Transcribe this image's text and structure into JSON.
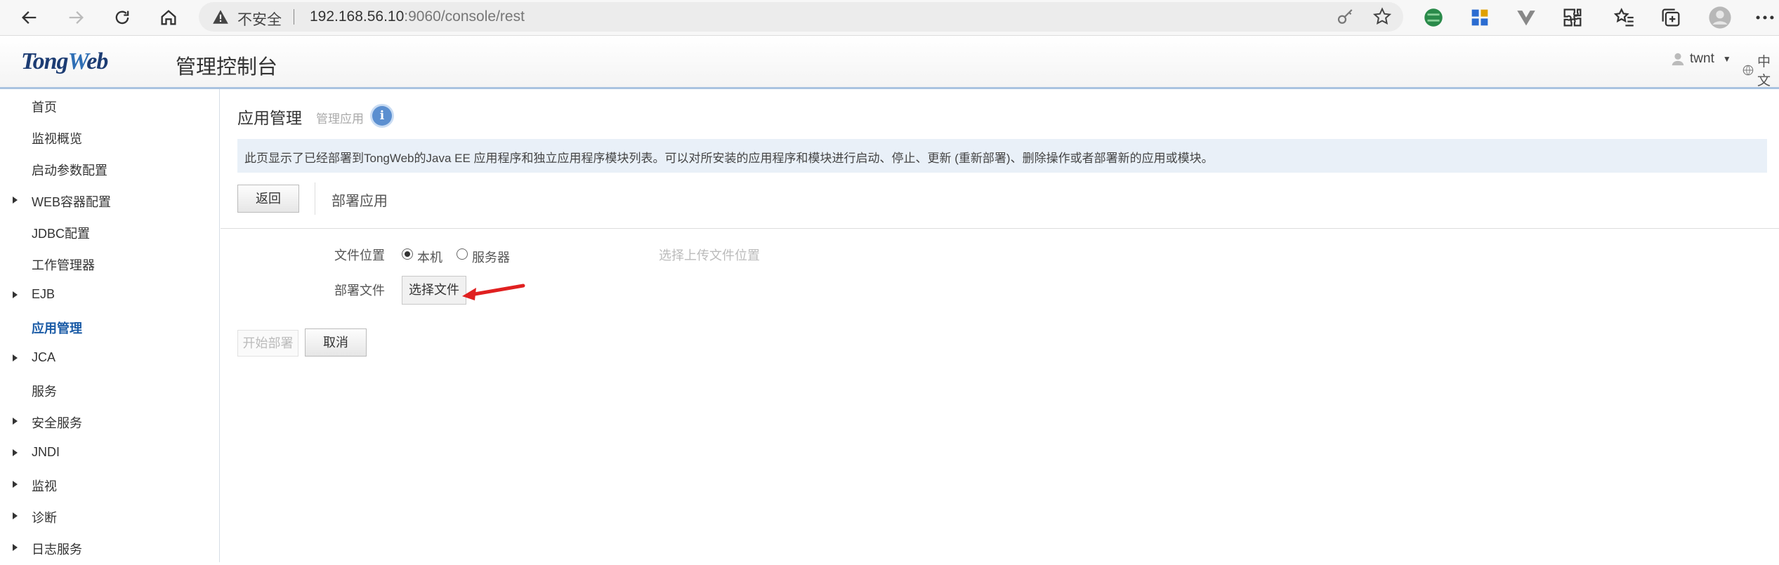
{
  "browser": {
    "insecure_label": "不安全",
    "url_host": "192.168.56.10",
    "url_rest": ":9060/console/rest"
  },
  "header": {
    "logo_tong": "Tong",
    "logo_w": "W",
    "logo_eb": "eb",
    "title": "管理控制台",
    "user": "twnt",
    "lang": "中文"
  },
  "sidebar": {
    "items": [
      {
        "label": "首页",
        "expandable": false
      },
      {
        "label": "监视概览",
        "expandable": false
      },
      {
        "label": "启动参数配置",
        "expandable": false
      },
      {
        "label": "WEB容器配置",
        "expandable": true
      },
      {
        "label": "JDBC配置",
        "expandable": false
      },
      {
        "label": "工作管理器",
        "expandable": false
      },
      {
        "label": "EJB",
        "expandable": true
      },
      {
        "label": "应用管理",
        "expandable": false,
        "active": true
      },
      {
        "label": "JCA",
        "expandable": true
      },
      {
        "label": "服务",
        "expandable": false
      },
      {
        "label": "安全服务",
        "expandable": true
      },
      {
        "label": "JNDI",
        "expandable": true
      },
      {
        "label": "监视",
        "expandable": true
      },
      {
        "label": "诊断",
        "expandable": true
      },
      {
        "label": "日志服务",
        "expandable": true
      }
    ]
  },
  "main": {
    "title": "应用管理",
    "subtitle": "管理应用",
    "info_glyph": "i",
    "notice": "此页显示了已经部署到TongWeb的Java EE 应用程序和独立应用程序模块列表。可以对所安装的应用程序和模块进行启动、停止、更新 (重新部署)、删除操作或者部署新的应用或模块。",
    "back_label": "返回",
    "deploy_title": "部署应用",
    "file_location_label": "文件位置",
    "radio_local": "本机",
    "radio_server": "服务器",
    "upload_hint": "选择上传文件位置",
    "deploy_file_label": "部署文件",
    "choose_file_label": "选择文件",
    "start_deploy_label": "开始部署",
    "cancel_label": "取消"
  }
}
